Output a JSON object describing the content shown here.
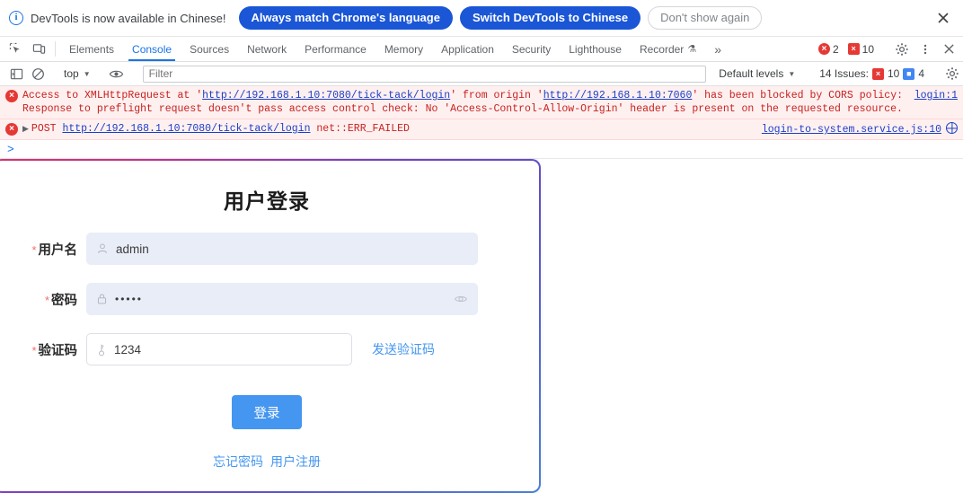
{
  "infobar": {
    "icon": "info-icon",
    "message": "DevTools is now available in Chinese!",
    "btn_always": "Always match Chrome's language",
    "btn_switch": "Switch DevTools to Chinese",
    "btn_dismiss": "Don't show again",
    "close_icon": "close-icon"
  },
  "tabstrip": {
    "inspect_icon": "inspect-element-icon",
    "device_icon": "device-toolbar-icon",
    "tabs": [
      {
        "label": "Elements",
        "active": false
      },
      {
        "label": "Console",
        "active": true
      },
      {
        "label": "Sources",
        "active": false
      },
      {
        "label": "Network",
        "active": false
      },
      {
        "label": "Performance",
        "active": false
      },
      {
        "label": "Memory",
        "active": false
      },
      {
        "label": "Application",
        "active": false
      },
      {
        "label": "Security",
        "active": false
      },
      {
        "label": "Lighthouse",
        "active": false
      },
      {
        "label": "Recorder",
        "active": false
      }
    ],
    "recorder_flask": "⚗",
    "more_tabs": "»",
    "error_count": "2",
    "warning_count": "10",
    "settings_icon": "gear-icon",
    "more_icon": "kebab-menu-icon",
    "close_icon": "close-devtools-icon"
  },
  "filterbar": {
    "sidebar_icon": "console-sidebar-icon",
    "clear_icon": "clear-console-icon",
    "context": "top",
    "eye_icon": "live-expression-icon",
    "filter_placeholder": "Filter",
    "filter_value": "",
    "levels": "Default levels",
    "issues_label": "14 Issues:",
    "issues_warning": "10",
    "issues_info": "4",
    "settings_icon": "console-settings-icon"
  },
  "console": {
    "messages": [
      {
        "icon": "error-icon",
        "line1_pre": "Access to XMLHttpRequest at '",
        "line1_link1": "http://192.168.1.10:7080/tick-tack/login",
        "line1_mid": "' from origin '",
        "line1_link2": "http://192.168.1.10:7060",
        "line1_post": "' has been blocked by CORS policy:",
        "line2": "Response to preflight request doesn't pass access control check: No 'Access-Control-Allow-Origin' header is present on the requested resource.",
        "source": "login:1"
      },
      {
        "icon": "error-icon",
        "expander": "▶",
        "method": "POST",
        "url": "http://192.168.1.10:7080/tick-tack/login",
        "status": "net::ERR_FAILED",
        "source": "login-to-system.service.js:10",
        "source_badge": "network-globe-icon"
      }
    ],
    "prompt": ">"
  },
  "login": {
    "title": "用户登录",
    "required_mark": "*",
    "username": {
      "label": "用户名",
      "icon": "user-icon",
      "value": "admin"
    },
    "password": {
      "label": "密码",
      "icon": "lock-icon",
      "value": "•••••",
      "toggle_icon": "eye-icon"
    },
    "captcha": {
      "label": "验证码",
      "icon": "key-icon",
      "value": "1234",
      "send_label": "发送验证码"
    },
    "submit_label": "登录",
    "forgot_password": "忘记密码",
    "register": "用户注册",
    "colors": {
      "accent": "#4596f0",
      "field_fill": "#e9edf8",
      "required": "#f56c6c",
      "border_gradient_start": "#d6336c",
      "border_gradient_end": "#4a7fd4"
    }
  }
}
